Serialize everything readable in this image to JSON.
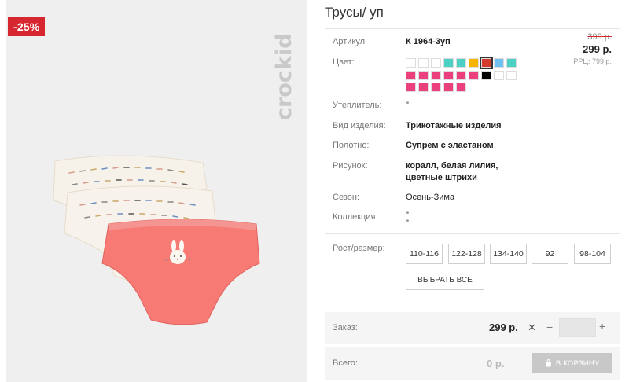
{
  "badge": {
    "discount": "-25%"
  },
  "brand": {
    "name": "crockid"
  },
  "product": {
    "title": "Трусы/ уп",
    "fields": {
      "article_label": "Артикул:",
      "article_value": "К 1964-3уп",
      "color_label": "Цвет:",
      "insulation_label": "Утеплитель:",
      "insulation_value": "\"",
      "type_label": "Вид изделия:",
      "type_value": "Трикотажные изделия",
      "fabric_label": "Полотно:",
      "fabric_value": "Супрем с эластаном",
      "pattern_label": "Рисунок:",
      "pattern_value_line1": "коралл, белая лилия,",
      "pattern_value_line2": "цветные штрихи",
      "season_label": "Сезон:",
      "season_value": "Осень-Зима",
      "collection_label": "Коллекция:",
      "collection_value_line1": "\"",
      "collection_value_line2": "\"",
      "size_label": "Рост/размер:"
    }
  },
  "price": {
    "old": "399 р.",
    "current": "299 р.",
    "rrp": "РРЦ: 799 р."
  },
  "colors": {
    "row1": [
      "#ffffff",
      "#ffffff",
      "#ffffff",
      "#4dd0c4",
      "#4dd0c4",
      "#f4b400",
      "#d33a2c",
      "#72c0f2",
      "#4dd0c4"
    ],
    "row2": [
      "#ec3f7d",
      "#ec3f7d",
      "#ec3f7d",
      "#ec3f7d",
      "#ec3f7d",
      "#ec3f7d",
      "#000000",
      "#ffffff",
      "#ffffff"
    ],
    "row3": [
      "#ec3f7d",
      "#ec3f7d",
      "#ec3f7d",
      "#ec3f7d",
      "#ec3f7d"
    ],
    "selected": "row1-6"
  },
  "sizes": [
    "110-116",
    "122-128",
    "134-140",
    "92",
    "98-104"
  ],
  "select_all": "ВЫБРАТЬ ВСЕ",
  "order": {
    "label": "Заказ:",
    "price": "299 р.",
    "times": "✕",
    "minus": "−",
    "plus": "+",
    "qty": ""
  },
  "total": {
    "label": "Всего:",
    "price": "0 р.",
    "cart_label": "В КОРЗИНУ"
  }
}
